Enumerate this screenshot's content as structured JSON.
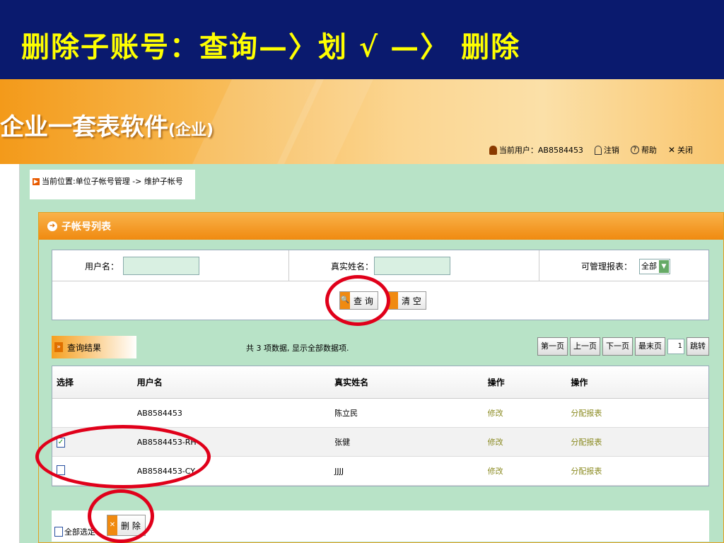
{
  "slide": {
    "title": "删除子账号：查询—〉划 √ —〉 删除"
  },
  "app": {
    "title": "企业一套表软件",
    "subtitle": "(企业)",
    "user_label": "当前用户：AB8584453",
    "logout": "注销",
    "help": "帮助",
    "close": "关闭"
  },
  "breadcrumb": {
    "icon": "▶",
    "text": "当前位置:单位子帐号管理 -> 维护子帐号"
  },
  "panel": {
    "title": "子帐号列表"
  },
  "search": {
    "username_label": "用户名：",
    "username_value": "",
    "realname_label": "真实姓名：",
    "realname_value": "",
    "reports_label": "可管理报表：",
    "reports_value": "全部",
    "query_button": "查 询",
    "clear_button": "清 空"
  },
  "results": {
    "title": "查询结果",
    "summary": "共 3 项数据, 显示全部数据项.",
    "pager": {
      "first": "第一页",
      "prev": "上一页",
      "next": "下一页",
      "last": "最末页",
      "page_value": "1",
      "jump": "跳转"
    }
  },
  "table": {
    "headers": [
      "选择",
      "用户名",
      "真实姓名",
      "操作",
      "操作"
    ],
    "rows": [
      {
        "checked": false,
        "username": "AB8584453",
        "realname": "陈立民",
        "edit": "修改",
        "assign": "分配报表"
      },
      {
        "checked": true,
        "username": "AB8584453-RH",
        "realname": "张健",
        "edit": "修改",
        "assign": "分配报表"
      },
      {
        "checked": false,
        "username": "AB8584453-CY",
        "realname": "JJJJ",
        "edit": "修改",
        "assign": "分配报表"
      }
    ]
  },
  "bottom": {
    "select_all": "全部选定",
    "delete_button": "删 除"
  },
  "colors": {
    "annotation": "#e0001a",
    "title_bg": "#0a1a6e",
    "title_text": "#ffff00",
    "accent": "#f08a10",
    "content_bg": "#b8e3c7"
  }
}
